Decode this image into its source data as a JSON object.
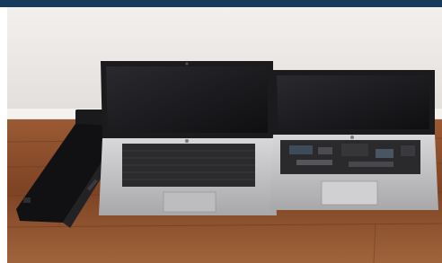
{
  "photo": {
    "subjects": [
      "docking-station",
      "laptop",
      "laptop"
    ],
    "colors": {
      "header_bar": "#153a5b",
      "wall": "#ebe8e5",
      "floor": "#8b4a2a",
      "laptop_dark": "#1c1c1e",
      "laptop_silver": "#c9c9cb"
    }
  }
}
